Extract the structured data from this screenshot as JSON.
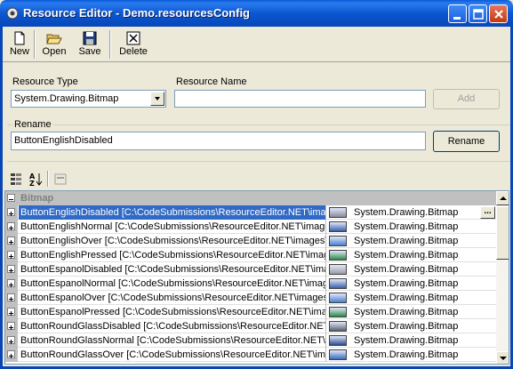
{
  "window": {
    "title": "Resource Editor - Demo.resourcesConfig"
  },
  "toolbar": {
    "new_label": "New",
    "open_label": "Open",
    "save_label": "Save",
    "delete_label": "Delete"
  },
  "form": {
    "resource_type_label": "Resource Type",
    "resource_type_value": "System.Drawing.Bitmap",
    "resource_name_label": "Resource Name",
    "resource_name_value": "",
    "add_label": "Add",
    "rename_label": "Rename",
    "rename_value": "ButtonEnglishDisabled",
    "rename_button_label": "Rename"
  },
  "grid": {
    "category": "Bitmap",
    "rows": [
      {
        "name": "ButtonEnglishDisabled  [C:\\CodeSubmissions\\ResourceEditor.NET\\images\\",
        "type": "System.Drawing.Bitmap",
        "selected": true,
        "thumb": "#8a8a9a"
      },
      {
        "name": "ButtonEnglishNormal  [C:\\CodeSubmissions\\ResourceEditor.NET\\images\\",
        "type": "System.Drawing.Bitmap",
        "thumb": "#3a5fa8"
      },
      {
        "name": "ButtonEnglishOver  [C:\\CodeSubmissions\\ResourceEditor.NET\\images\\",
        "type": "System.Drawing.Bitmap",
        "thumb": "#4a7fd0"
      },
      {
        "name": "ButtonEnglishPressed  [C:\\CodeSubmissions\\ResourceEditor.NET\\images\\",
        "type": "System.Drawing.Bitmap",
        "thumb": "#2e8a4a"
      },
      {
        "name": "ButtonEspanolDisabled  [C:\\CodeSubmissions\\ResourceEditor.NET\\images\\",
        "type": "System.Drawing.Bitmap",
        "thumb": "#9a9aa8"
      },
      {
        "name": "ButtonEspanolNormal  [C:\\CodeSubmissions\\ResourceEditor.NET\\images\\",
        "type": "System.Drawing.Bitmap",
        "thumb": "#3a5fa8"
      },
      {
        "name": "ButtonEspanolOver  [C:\\CodeSubmissions\\ResourceEditor.NET\\images\\",
        "type": "System.Drawing.Bitmap",
        "thumb": "#4a7fd0"
      },
      {
        "name": "ButtonEspanolPressed  [C:\\CodeSubmissions\\ResourceEditor.NET\\images\\",
        "type": "System.Drawing.Bitmap",
        "thumb": "#2e8a4a"
      },
      {
        "name": "ButtonRoundGlassDisabled  [C:\\CodeSubmissions\\ResourceEditor.NET\\images\\",
        "type": "System.Drawing.Bitmap",
        "thumb": "#5a6070"
      },
      {
        "name": "ButtonRoundGlassNormal  [C:\\CodeSubmissions\\ResourceEditor.NET\\images\\",
        "type": "System.Drawing.Bitmap",
        "thumb": "#2a4a90"
      },
      {
        "name": "ButtonRoundGlassOver  [C:\\CodeSubmissions\\ResourceEditor.NET\\images\\",
        "type": "System.Drawing.Bitmap",
        "thumb": "#3a6ab8"
      }
    ],
    "ellipsis_label": "..."
  },
  "colors": {
    "titlebar": "#0b57d0",
    "selection": "#316ac5",
    "window_bg": "#ece9d8"
  }
}
